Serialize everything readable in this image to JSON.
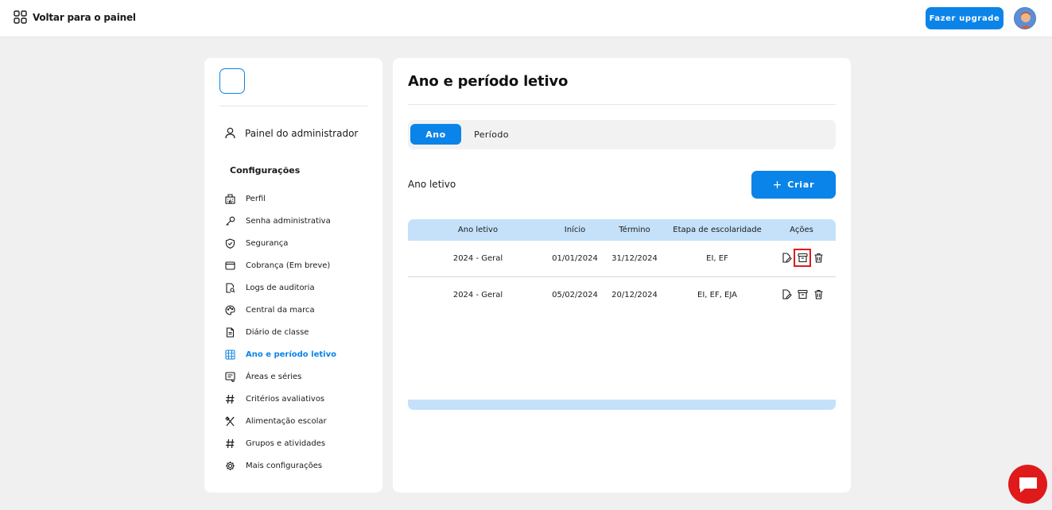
{
  "topbar": {
    "back_label": "Voltar para o painel",
    "upgrade_label": "Fazer upgrade"
  },
  "sidebar": {
    "admin_label": "Painel do administrador",
    "section_title": "Configurações",
    "items": [
      {
        "label": "Perfil",
        "icon": "building-icon"
      },
      {
        "label": "Senha administrativa",
        "icon": "key-icon"
      },
      {
        "label": "Segurança",
        "icon": "shield-icon"
      },
      {
        "label": "Cobrança (Em breve)",
        "icon": "wallet-icon"
      },
      {
        "label": "Logs de auditoria",
        "icon": "document-search-icon"
      },
      {
        "label": "Central da marca",
        "icon": "palette-icon"
      },
      {
        "label": "Diário de classe",
        "icon": "notebook-icon"
      },
      {
        "label": "Ano e período letivo",
        "icon": "calendar-grid-icon",
        "active": true
      },
      {
        "label": "Áreas e séries",
        "icon": "list-icon"
      },
      {
        "label": "Critérios avaliativos",
        "icon": "hash-icon"
      },
      {
        "label": "Alimentação escolar",
        "icon": "utensils-icon"
      },
      {
        "label": "Grupos e atividades",
        "icon": "hash-icon"
      },
      {
        "label": "Mais configurações",
        "icon": "gear-icon"
      }
    ]
  },
  "main": {
    "title": "Ano e período letivo",
    "tabs": [
      {
        "label": "Ano",
        "active": true
      },
      {
        "label": "Período",
        "active": false
      }
    ],
    "section_label": "Ano letivo",
    "create_label": "Criar",
    "table": {
      "headers": [
        "Ano letivo",
        "Início",
        "Término",
        "Etapa de escolaridade",
        "Ações"
      ],
      "rows": [
        {
          "ano": "2024 - Geral",
          "inicio": "01/01/2024",
          "termino": "31/12/2024",
          "etapa": "EI, EF"
        },
        {
          "ano": "2024 - Geral",
          "inicio": "05/02/2024",
          "termino": "20/12/2024",
          "etapa": "EI, EF, EJA"
        }
      ]
    }
  },
  "colors": {
    "accent": "#0a84e8",
    "table_header": "#c5e1fa",
    "chat": "#e01a1a"
  }
}
